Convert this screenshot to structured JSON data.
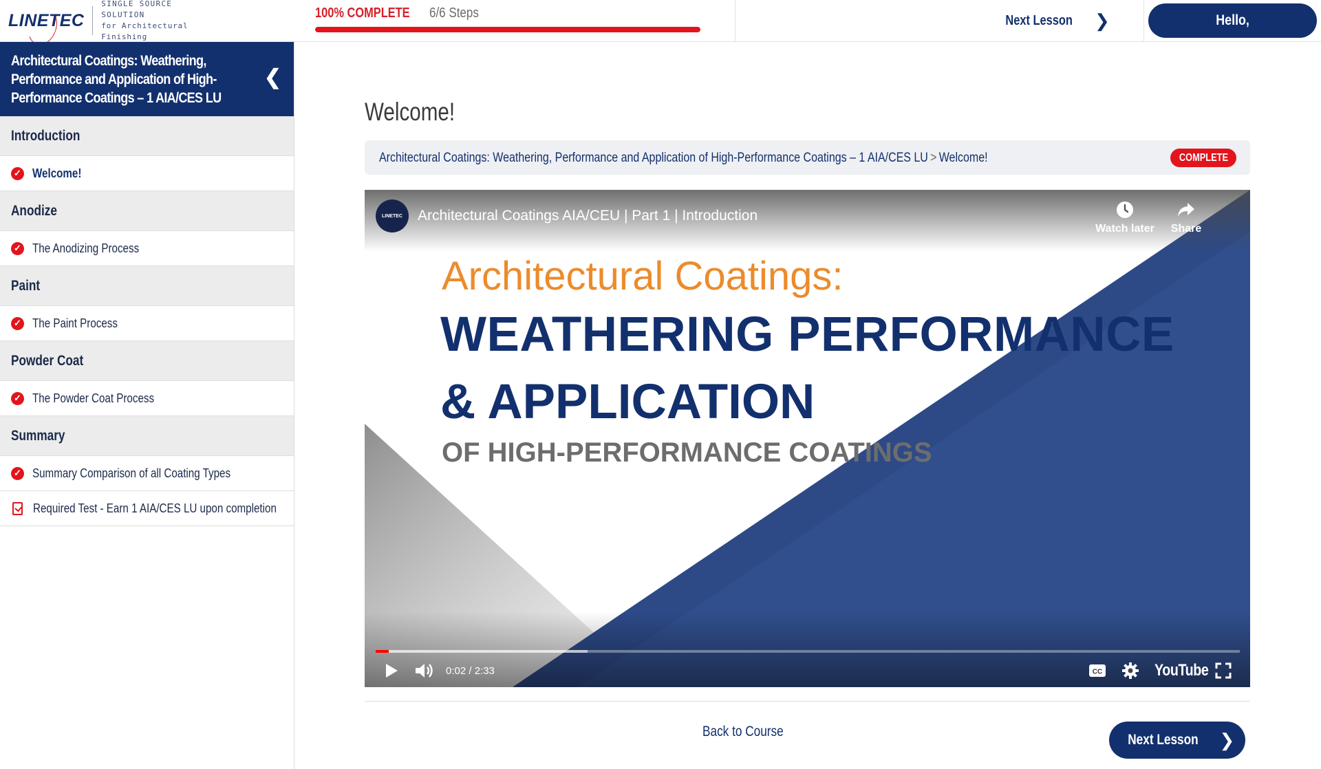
{
  "brand": {
    "logo_text": "LINETEC",
    "tagline_1": "SINGLE SOURCE SOLUTION",
    "tagline_2": "for Architectural Finishing",
    "primary_color": "#13306e",
    "accent_color": "#e2141c"
  },
  "header": {
    "progress_label": "100% COMPLETE",
    "progress_steps": "6/6 Steps",
    "progress_fraction": 1.0,
    "next_lesson_label": "Next Lesson",
    "hello_label": "Hello,"
  },
  "sidebar": {
    "course_title": "Architectural Coatings: Weathering, Performance and Application of High-Performance Coatings – 1 AIA/CES LU",
    "sections": [
      {
        "label": "Introduction",
        "items": [
          {
            "label": "Welcome!",
            "status": "complete",
            "active": true
          }
        ]
      },
      {
        "label": "Anodize",
        "items": [
          {
            "label": "The Anodizing Process",
            "status": "complete"
          }
        ]
      },
      {
        "label": "Paint",
        "items": [
          {
            "label": "The Paint Process",
            "status": "complete"
          }
        ]
      },
      {
        "label": "Powder Coat",
        "items": [
          {
            "label": "The Powder Coat Process",
            "status": "complete"
          }
        ]
      },
      {
        "label": "Summary",
        "items": [
          {
            "label": "Summary Comparison of all Coating Types",
            "status": "complete"
          },
          {
            "label": "Required Test - Earn 1 AIA/CES LU upon completion",
            "status": "quiz"
          }
        ]
      }
    ]
  },
  "main": {
    "page_title": "Welcome!",
    "breadcrumb_course": "Architectural Coatings: Weathering, Performance and Application of High-Performance Coatings – 1 AIA/CES LU",
    "breadcrumb_separator": ">",
    "breadcrumb_current": "Welcome!",
    "status_badge": "COMPLETE",
    "back_to_course": "Back to Course",
    "next_lesson_label": "Next Lesson"
  },
  "video": {
    "channel_badge": "LINETEC",
    "title": "Architectural Coatings AIA/CEU | Part 1 | Introduction",
    "watch_later": "Watch later",
    "share": "Share",
    "slide_line_1": "Architectural Coatings:",
    "slide_line_2": "WEATHERING PERFORMANCE",
    "slide_line_3": "& APPLICATION",
    "slide_line_4": "OF HIGH-PERFORMANCE COATINGS",
    "time_display": "0:02 / 2:33",
    "played_fraction": 0.015,
    "buffered_fraction": 0.245,
    "youtube_label": "YouTube",
    "icons": [
      "play-icon",
      "volume-icon",
      "captions-icon",
      "settings-icon",
      "fullscreen-icon",
      "clock-icon",
      "share-arrow-icon"
    ]
  }
}
